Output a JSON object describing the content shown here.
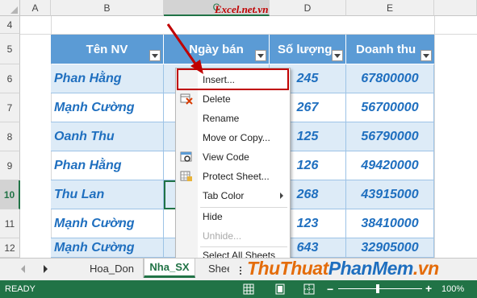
{
  "columns": [
    "A",
    "B",
    "C",
    "D",
    "E"
  ],
  "rows": [
    "4",
    "5",
    "6",
    "7",
    "8",
    "9",
    "10",
    "11",
    "12"
  ],
  "table": {
    "headers": [
      "Tên NV",
      "Ngày bán",
      "Số lượng",
      "Doanh thu"
    ],
    "names": [
      "Phan Hằng",
      "Mạnh Cường",
      "Oanh Thu",
      "Phan Hằng",
      "Thu Lan",
      "Mạnh Cường",
      "Mạnh Cường"
    ],
    "quantities": [
      "245",
      "267",
      "125",
      "126",
      "268",
      "123",
      "643"
    ],
    "revenues": [
      "67800000",
      "56700000",
      "56790000",
      "49420000",
      "43915000",
      "38410000",
      "32905000"
    ]
  },
  "context_menu": {
    "items": [
      "Insert...",
      "Delete",
      "Rename",
      "Move or Copy...",
      "View Code",
      "Protect Sheet...",
      "Tab Color",
      "Hide",
      "Unhide...",
      "Select All Sheets"
    ]
  },
  "sheet_tabs": [
    "Hoa_Don",
    "Nha_SX",
    "Shee"
  ],
  "status": {
    "ready": "READY",
    "zoom": "100%"
  },
  "watermark": {
    "top": "Excel.net.vn",
    "bottom_a": "ThuThuat",
    "bottom_b": "PhanMem",
    "bottom_c": ".vn"
  },
  "colors": {
    "excel_green": "#217346",
    "table_header": "#5b9bd5",
    "band": "#ddebf7",
    "highlight_red": "#c00000"
  }
}
